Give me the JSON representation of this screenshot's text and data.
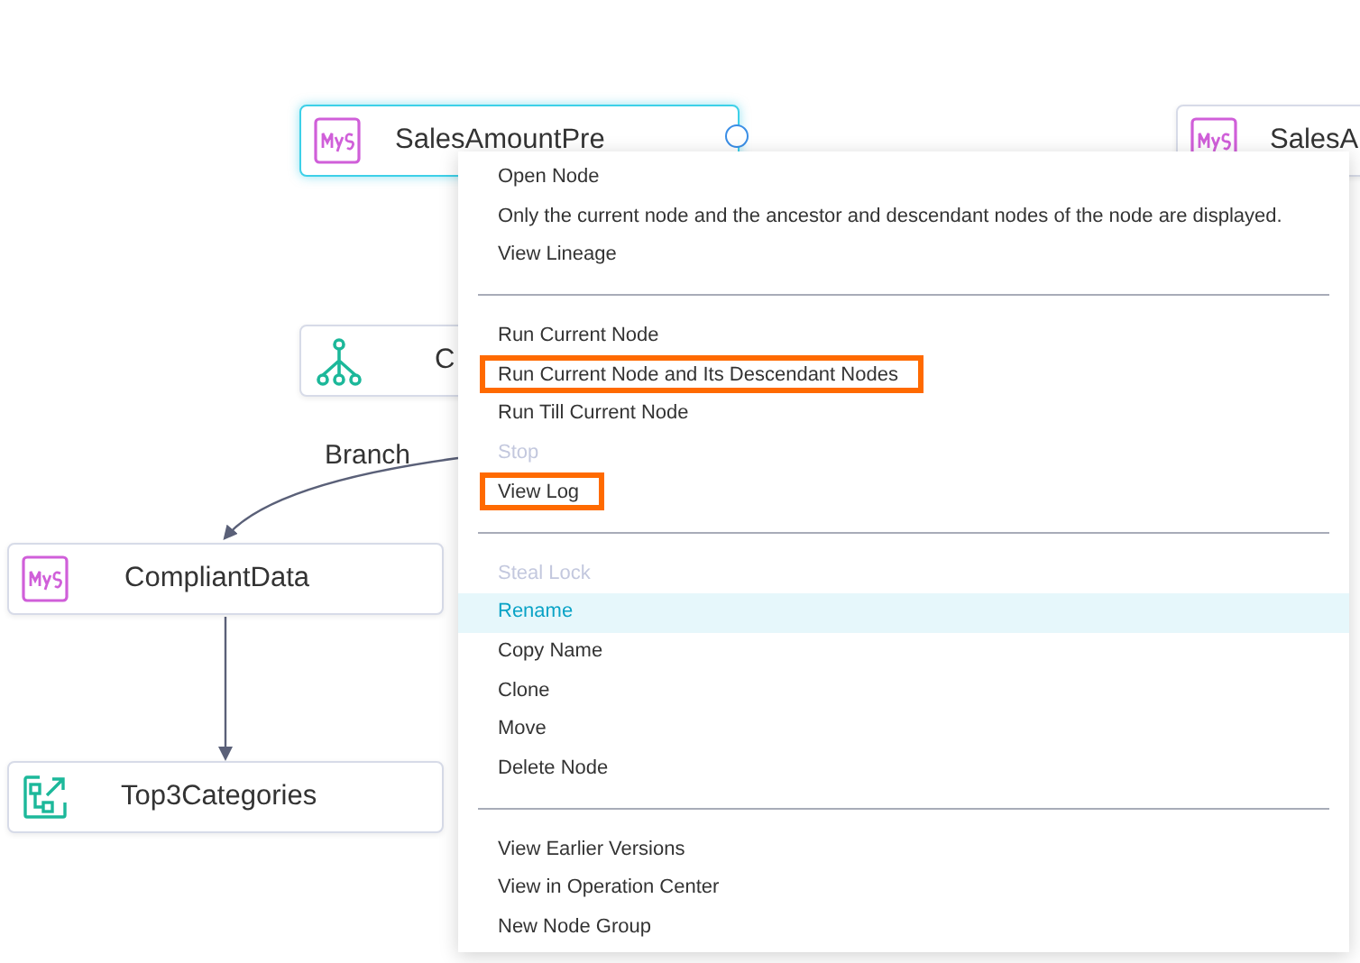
{
  "canvas": {
    "nodes": [
      {
        "kind": "mysql",
        "label": "SalesAmountPre",
        "selected": true
      },
      {
        "kind": "mysql",
        "label": "SalesA",
        "selected": false
      },
      {
        "kind": "branch",
        "label": "C",
        "selected": false
      },
      {
        "kind": "mysql",
        "label": "CompliantData",
        "selected": false
      },
      {
        "kind": "chart",
        "label": "Top3Categories",
        "selected": false
      }
    ],
    "edge_label": "Branch"
  },
  "context_menu": {
    "groups": [
      {
        "items": [
          {
            "label": "Open Node",
            "disabled": false,
            "hovered": false,
            "outlined": false
          },
          {
            "label": "Only the current node and the ancestor and descendant nodes of the node are displayed.",
            "disabled": false,
            "hovered": false,
            "outlined": false
          },
          {
            "label": "View Lineage",
            "disabled": false,
            "hovered": false,
            "outlined": false
          }
        ]
      },
      {
        "items": [
          {
            "label": "Run Current Node",
            "disabled": false,
            "hovered": false,
            "outlined": false
          },
          {
            "label": "Run Current Node and Its Descendant Nodes",
            "disabled": false,
            "hovered": false,
            "outlined": true
          },
          {
            "label": "Run Till Current Node",
            "disabled": false,
            "hovered": false,
            "outlined": false
          },
          {
            "label": "Stop",
            "disabled": true,
            "hovered": false,
            "outlined": false
          },
          {
            "label": "View Log",
            "disabled": false,
            "hovered": false,
            "outlined": true
          }
        ]
      },
      {
        "items": [
          {
            "label": "Steal Lock",
            "disabled": true,
            "hovered": false,
            "outlined": false
          },
          {
            "label": "Rename",
            "disabled": false,
            "hovered": true,
            "outlined": false
          },
          {
            "label": "Copy Name",
            "disabled": false,
            "hovered": false,
            "outlined": false
          },
          {
            "label": "Clone",
            "disabled": false,
            "hovered": false,
            "outlined": false
          },
          {
            "label": "Move",
            "disabled": false,
            "hovered": false,
            "outlined": false
          },
          {
            "label": "Delete Node",
            "disabled": false,
            "hovered": false,
            "outlined": false
          }
        ]
      },
      {
        "items": [
          {
            "label": "View Earlier Versions",
            "disabled": false,
            "hovered": false,
            "outlined": false
          },
          {
            "label": "View in Operation Center",
            "disabled": false,
            "hovered": false,
            "outlined": false
          },
          {
            "label": "New Node Group",
            "disabled": false,
            "hovered": false,
            "outlined": false
          }
        ]
      }
    ]
  }
}
